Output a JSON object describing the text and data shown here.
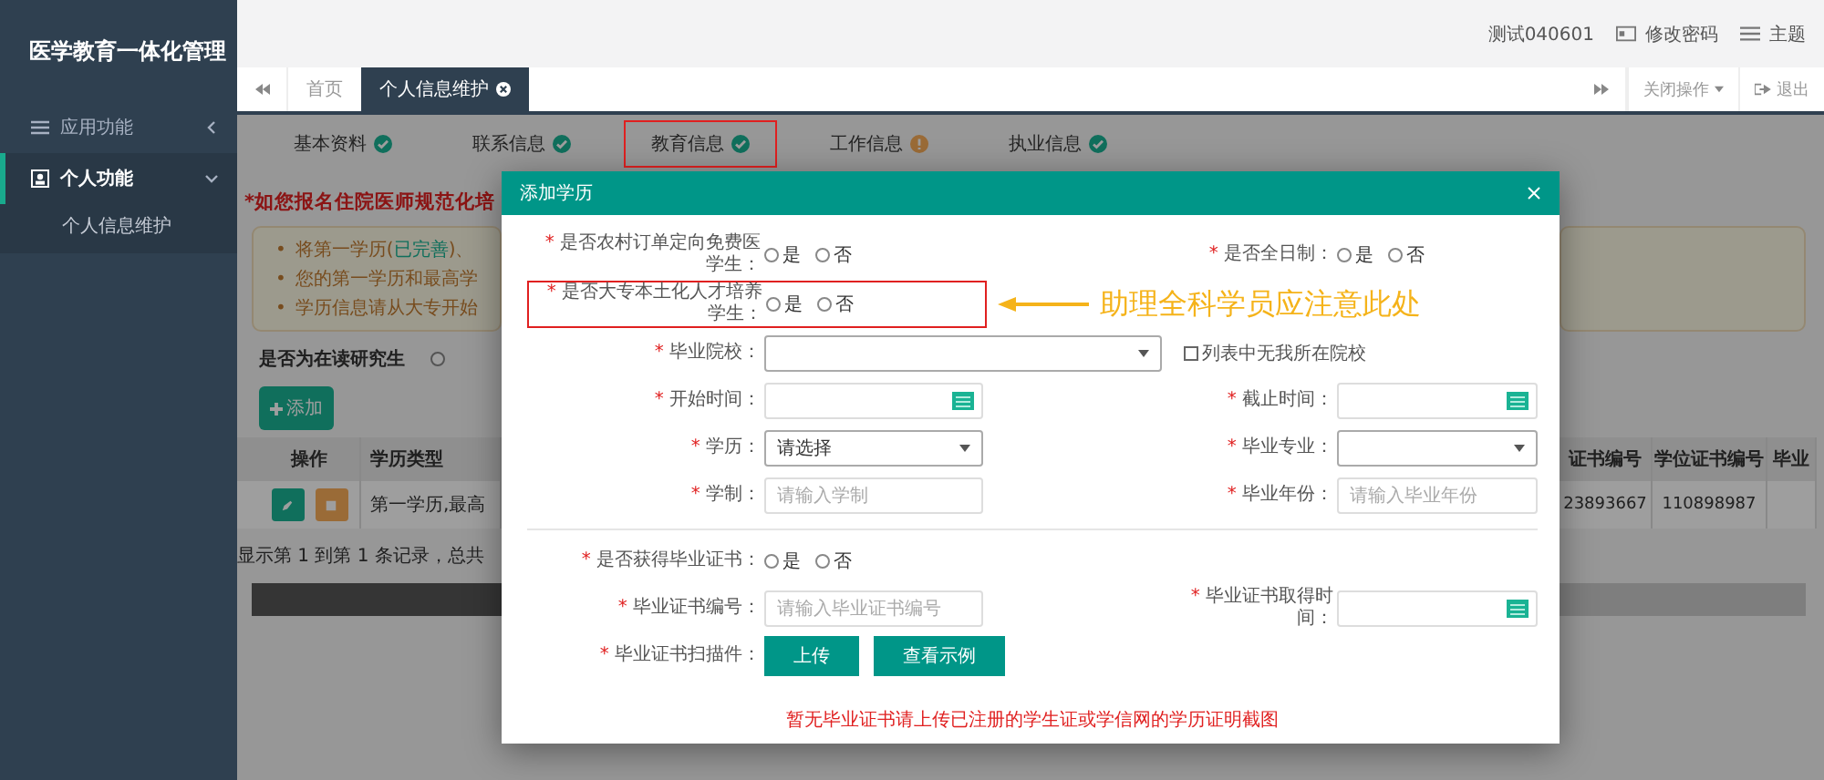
{
  "sidebar": {
    "title": "医学教育一体化管理",
    "menu": [
      {
        "label": "应用功能",
        "expanded": false,
        "selected": false
      },
      {
        "label": "个人功能",
        "expanded": true,
        "selected": true,
        "children": [
          {
            "label": "个人信息维护"
          }
        ]
      }
    ]
  },
  "topbar": {
    "user": "测试040601",
    "links": [
      {
        "label": "修改密码",
        "kind": "password"
      },
      {
        "label": "主题",
        "kind": "theme"
      }
    ]
  },
  "page_tabs": {
    "items": [
      {
        "label": "首页",
        "selected": false,
        "closable": false
      },
      {
        "label": "个人信息维护",
        "selected": true,
        "closable": true
      }
    ],
    "actions": [
      {
        "label": "关闭操作",
        "kind": "dropdown"
      },
      {
        "label": "退出",
        "kind": "exit"
      }
    ]
  },
  "info_tabs": [
    {
      "label": "基本资料",
      "complete": true,
      "highlighted": false
    },
    {
      "label": "联系信息",
      "complete": true,
      "highlighted": false
    },
    {
      "label": "教育信息",
      "complete": true,
      "highlighted": true
    },
    {
      "label": "工作信息",
      "complete": false,
      "highlighted": false
    },
    {
      "label": "执业信息",
      "complete": true,
      "highlighted": false
    }
  ],
  "notice": {
    "heading": "*如您报名住院医师规范化培",
    "bullets": [
      {
        "marker": "•",
        "parts": [
          {
            "text": "将第一学历(",
            "kind": "plain"
          },
          {
            "text": "已完善",
            "kind": "done"
          },
          {
            "text": ")、",
            "kind": "plain"
          }
        ]
      },
      {
        "marker": "•",
        "parts": [
          {
            "text": "您的第一学历和最高学",
            "kind": "plain"
          }
        ]
      },
      {
        "marker": "•",
        "parts": [
          {
            "text": "学历信息请从大专开始",
            "kind": "plain"
          }
        ]
      }
    ]
  },
  "graduate_question": {
    "label": "是否为在读研究生",
    "options": [
      {
        "selected": false
      }
    ]
  },
  "add_button": "添加",
  "table": {
    "columns": [
      {
        "label": "操作"
      },
      {
        "label": "学历类型"
      },
      {
        "label": "证书编号"
      },
      {
        "label": "学位证书编号"
      },
      {
        "label": "毕业"
      }
    ],
    "rows": [
      {
        "type": "第一学历,最高",
        "certificate": "23893667",
        "degree": "110898987"
      }
    ],
    "footer": "显示第 1 到第 1 条记录，总共"
  },
  "modal": {
    "title": "添加学历",
    "rows": [
      {
        "left": {
          "mark": "*",
          "label": "是否农村订单定向免费医学生：",
          "kind": "radio",
          "options": [
            {
              "label": "是",
              "selected": false
            },
            {
              "label": "否",
              "selected": false
            }
          ]
        },
        "right": {
          "mark": "*",
          "label": "是否全日制：",
          "kind": "radio",
          "options": [
            {
              "label": "是",
              "selected": false
            },
            {
              "label": "否",
              "selected": false
            }
          ]
        }
      },
      {
        "left": {
          "mark": "*",
          "label": "是否大专本土化人才培养学生：",
          "kind": "radio",
          "annotated": true,
          "options": [
            {
              "label": "是",
              "selected": false
            },
            {
              "label": "否",
              "selected": false
            }
          ]
        },
        "annotation": "助理全科学员应注意此处"
      },
      {
        "left": {
          "mark": "*",
          "label": "毕业院校：",
          "kind": "select",
          "wide": true
        },
        "right": {
          "kind": "checkbox",
          "label": "列表中无我所在院校",
          "checked": false
        }
      },
      {
        "left": {
          "mark": "*",
          "label": "开始时间：",
          "kind": "date"
        },
        "right": {
          "mark": "*",
          "label": "截止时间：",
          "kind": "date"
        }
      },
      {
        "left": {
          "mark": "*",
          "label": "学历：",
          "kind": "select",
          "value": "请选择"
        },
        "right": {
          "mark": "*",
          "label": "毕业专业：",
          "kind": "select"
        }
      },
      {
        "left": {
          "mark": "*",
          "label": "学制：",
          "kind": "text",
          "placeholder": "请输入学制"
        },
        "right": {
          "mark": "*",
          "label": "毕业年份：",
          "kind": "text",
          "placeholder": "请输入毕业年份"
        }
      },
      {
        "divider_before": true,
        "left": {
          "mark": "*",
          "label": "是否获得毕业证书：",
          "kind": "radio",
          "options": [
            {
              "label": "是",
              "selected": false
            },
            {
              "label": "否",
              "selected": false
            }
          ]
        }
      },
      {
        "left": {
          "mark": "*",
          "label": "毕业证书编号：",
          "kind": "text",
          "placeholder": "请输入毕业证书编号"
        },
        "right": {
          "mark": "*",
          "label": "毕业证书取得时间：",
          "kind": "date"
        }
      },
      {
        "left": {
          "mark": "*",
          "label": "毕业证书扫描件：",
          "kind": "buttons",
          "buttons": [
            "上传",
            "查看示例"
          ]
        }
      }
    ],
    "note": "暂无毕业证书请上传已注册的学生证或学信网的学历证明截图"
  }
}
